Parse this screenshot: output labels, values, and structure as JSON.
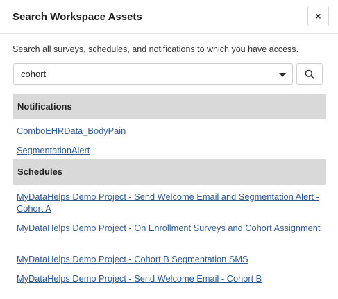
{
  "dialog": {
    "title": "Search Workspace Assets",
    "close_label": "×",
    "description": "Search all surveys, schedules, and notifications to which you have access."
  },
  "search": {
    "value": "cohort",
    "button_icon": "search-icon"
  },
  "sections": {
    "notifications": {
      "header": "Notifications",
      "items": [
        "ComboEHRData_BodyPain",
        "SegmentationAlert"
      ]
    },
    "schedules": {
      "header": "Schedules",
      "items": [
        "MyDataHelps Demo Project - Send Welcome Email and Segmentation Alert - Cohort A",
        "MyDataHelps Demo Project - On Enrollment Surveys and Cohort Assignment",
        "MyDataHelps Demo Project - Cohort B Segmentation SMS",
        "MyDataHelps Demo Project - Send Welcome Email - Cohort B"
      ]
    }
  },
  "colors": {
    "link": "#2f5a8f",
    "section_header_bg": "#d9d9d9"
  }
}
